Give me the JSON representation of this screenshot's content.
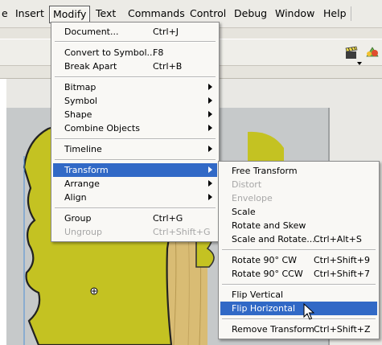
{
  "menubar": {
    "items": [
      {
        "label": "e"
      },
      {
        "label": "Insert"
      },
      {
        "label": "Modify"
      },
      {
        "label": "Text"
      },
      {
        "label": "Commands"
      },
      {
        "label": "Control"
      },
      {
        "label": "Debug"
      },
      {
        "label": "Window"
      },
      {
        "label": "Help"
      }
    ],
    "active": "Modify"
  },
  "modify_menu": {
    "items": [
      {
        "label": "Document...",
        "shortcut": "Ctrl+J"
      },
      {
        "label": "Convert to Symbol...",
        "shortcut": "F8"
      },
      {
        "label": "Break Apart",
        "shortcut": "Ctrl+B"
      },
      {
        "label": "Bitmap",
        "submenu": true
      },
      {
        "label": "Symbol",
        "submenu": true
      },
      {
        "label": "Shape",
        "submenu": true
      },
      {
        "label": "Combine Objects",
        "submenu": true
      },
      {
        "label": "Timeline",
        "submenu": true
      },
      {
        "label": "Transform",
        "submenu": true,
        "selected": true
      },
      {
        "label": "Arrange",
        "submenu": true
      },
      {
        "label": "Align",
        "submenu": true
      },
      {
        "label": "Group",
        "shortcut": "Ctrl+G"
      },
      {
        "label": "Ungroup",
        "shortcut": "Ctrl+Shift+G",
        "disabled": true
      }
    ]
  },
  "transform_menu": {
    "items": [
      {
        "label": "Free Transform"
      },
      {
        "label": "Distort",
        "disabled": true
      },
      {
        "label": "Envelope",
        "disabled": true
      },
      {
        "label": "Scale"
      },
      {
        "label": "Rotate and Skew"
      },
      {
        "label": "Scale and Rotate...",
        "shortcut": "Ctrl+Alt+S"
      },
      {
        "label": "Rotate 90° CW",
        "shortcut": "Ctrl+Shift+9"
      },
      {
        "label": "Rotate 90° CCW",
        "shortcut": "Ctrl+Shift+7"
      },
      {
        "label": "Flip Vertical"
      },
      {
        "label": "Flip Horizontal",
        "selected": true
      },
      {
        "label": "Remove Transform",
        "shortcut": "Ctrl+Shift+Z"
      }
    ]
  },
  "colors": {
    "menu_highlight": "#3169c6",
    "disabled_text": "#a7a7a7",
    "shape_fill": "#c3c120",
    "wood_fill": "#dcc07a"
  },
  "icons": [
    "clapper-icon",
    "chevron-down-icon",
    "color-wheel-icon",
    "arrow-cursor-icon",
    "registration-point-icon"
  ]
}
